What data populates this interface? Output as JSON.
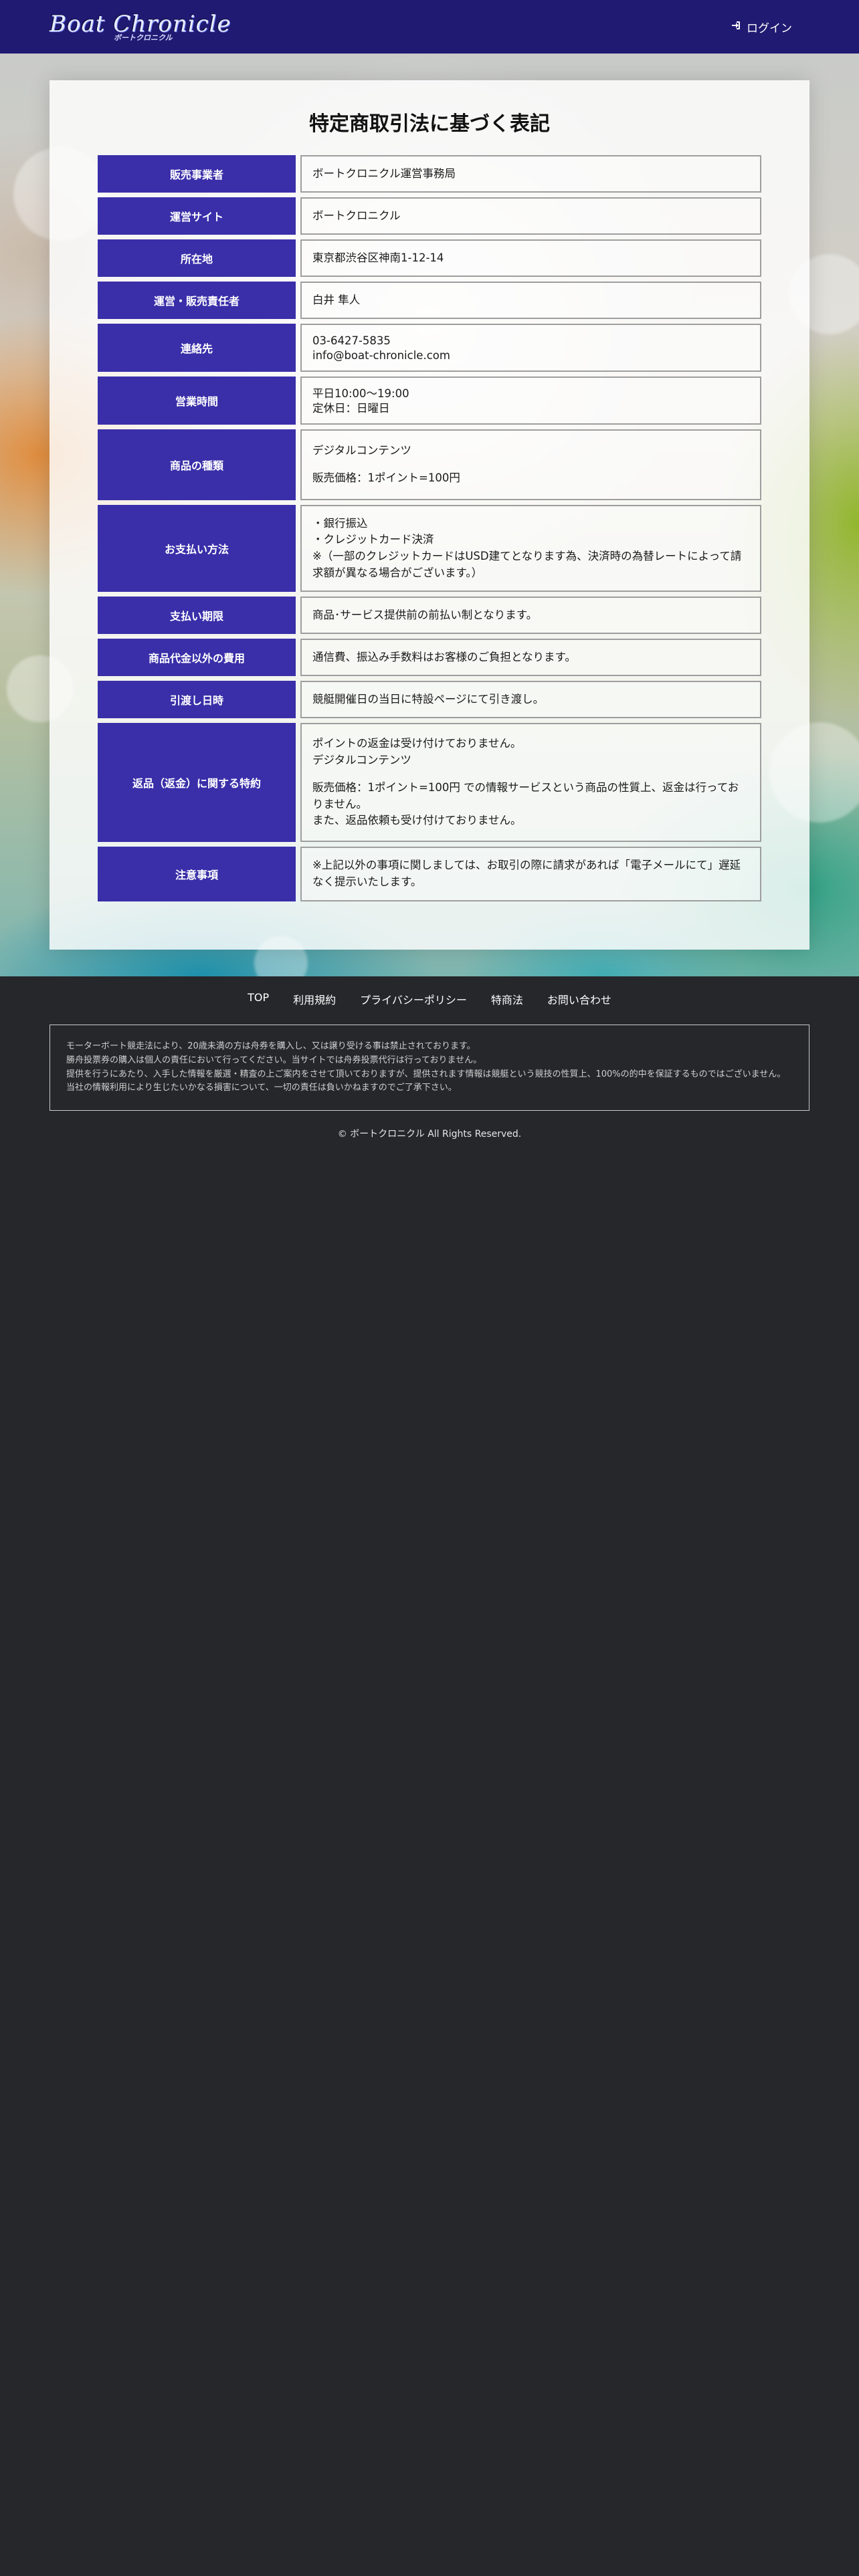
{
  "header": {
    "logo_main": "Boat Chronicle",
    "logo_sub": "ボートクロニクル",
    "login_label": "ログイン",
    "login_icon": "sign-in-icon"
  },
  "page": {
    "title": "特定商取引法に基づく表記"
  },
  "rows": [
    {
      "label": "販売事業者",
      "lines": [
        "ボートクロニクル運営事務局"
      ]
    },
    {
      "label": "運営サイト",
      "lines": [
        "ボートクロニクル"
      ]
    },
    {
      "label": "所在地",
      "lines": [
        "東京都渋谷区神南1-12-14"
      ]
    },
    {
      "label": "運営・販売責任者",
      "lines": [
        "白井 隼人"
      ]
    },
    {
      "label": "連絡先",
      "lines": [
        "03-6427-5835",
        "info@boat-chronicle.com"
      ]
    },
    {
      "label": "営業時間",
      "lines": [
        "平日10:00〜19:00",
        "定休日：日曜日"
      ]
    },
    {
      "label": "商品の種類",
      "lines": [
        "デジタルコンテンツ",
        "",
        "販売価格：1ポイント=100円"
      ]
    },
    {
      "label": "お支払い方法",
      "lines": [
        "・銀行振込",
        "・クレジットカード決済",
        "※（一部のクレジットカードはUSD建てとなります為、決済時の為替レートによって請求額が異なる場合がございます。）"
      ]
    },
    {
      "label": "支払い期限",
      "lines": [
        "商品･サービス提供前の前払い制となります。"
      ]
    },
    {
      "label": "商品代金以外の費用",
      "lines": [
        "通信費、振込み手数料はお客様のご負担となります。"
      ]
    },
    {
      "label": "引渡し日時",
      "lines": [
        "競艇開催日の当日に特設ページにて引き渡し。"
      ]
    },
    {
      "label": "返品（返金）に関する特約",
      "lines": [
        "ポイントの返金は受け付けておりません。",
        "デジタルコンテンツ",
        "",
        "販売価格：1ポイント=100円 での情報サービスという商品の性質上、返金は行っておりません。",
        "また、返品依頼も受け付けておりません。"
      ]
    },
    {
      "label": "注意事項",
      "lines": [
        "※上記以外の事項に関しましては、お取引の際に請求があれば「電子メールにて」遅延なく提示いたします。"
      ]
    }
  ],
  "footer": {
    "nav": [
      "TOP",
      "利用規約",
      "プライバシーポリシー",
      "特商法",
      "お問い合わせ"
    ],
    "disclaimer": [
      "モーターボート競走法により、20歳未満の方は舟券を購入し、又は譲り受ける事は禁止されております。",
      "勝舟投票券の購入は個人の責任において行ってください。当サイトでは舟券投票代行は行っておりません。",
      "提供を行うにあたり、入手した情報を厳選・精査の上ご案内をさせて頂いておりますが、提供されます情報は競艇という競技の性質上、100%の的中を保証するものではございません。",
      "当社の情報利用により生じたいかなる損害について、一切の責任は負いかねますのでご了承下さい。"
    ],
    "copyright": "© ボートクロニクル All Rights Reserved."
  }
}
